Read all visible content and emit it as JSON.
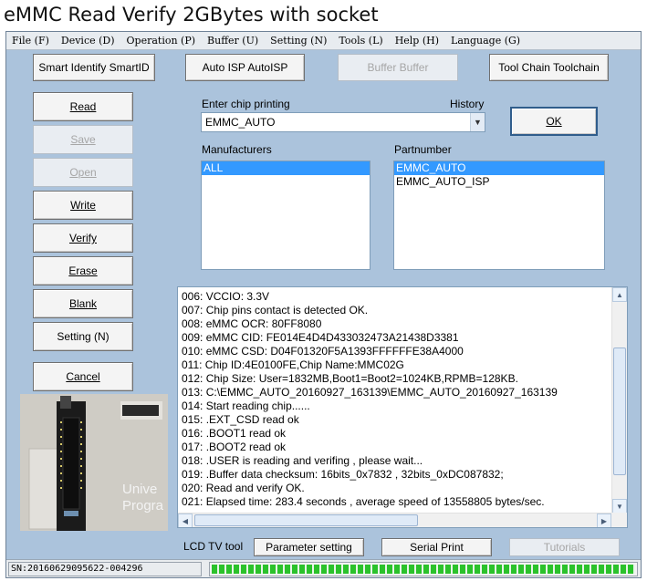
{
  "page_heading": "eMMC Read Verify 2GBytes with socket",
  "menu": [
    {
      "label": "File (F)"
    },
    {
      "label": "Device (D)"
    },
    {
      "label": "Operation (P)"
    },
    {
      "label": "Buffer (U)"
    },
    {
      "label": "Setting (N)"
    },
    {
      "label": "Tools (L)"
    },
    {
      "label": "Help (H)"
    },
    {
      "label": "Language (G)"
    }
  ],
  "top_toolbar": {
    "smart_identify": "Smart Identify SmartID",
    "auto_isp": "Auto ISP AutoISP",
    "buffer": "Buffer Buffer",
    "tool_chain": "Tool Chain Toolchain"
  },
  "left_buttons": {
    "read": "Read",
    "save": "Save",
    "open": "Open",
    "write": "Write",
    "verify": "Verify",
    "erase": "Erase",
    "blank": "Blank",
    "setting": "Setting (N)",
    "cancel": "Cancel"
  },
  "chip_select": {
    "enter_label": "Enter chip printing",
    "history_label": "History",
    "value": "EMMC_AUTO",
    "ok_label": "OK",
    "manufacturers_label": "Manufacturers",
    "partnumber_label": "Partnumber",
    "manufacturers": [
      "ALL"
    ],
    "partnumbers": [
      "EMMC_AUTO",
      "EMMC_AUTO_ISP"
    ]
  },
  "log": [
    "006: VCCIO: 3.3V",
    "007: Chip pins contact is detected OK.",
    "008: eMMC OCR: 80FF8080",
    "009: eMMC CID:  FE014E4D4D433032473A21438D3381",
    "010: eMMC CSD: D04F01320F5A1393FFFFFFE38A4000",
    "011: Chip ID:4E0100FE,Chip Name:MMC02G",
    "012: Chip Size: User=1832MB,Boot1=Boot2=1024KB,RPMB=128KB.",
    "013: C:\\EMMC_AUTO_20160927_163139\\EMMC_AUTO_20160927_163139",
    "014: Start reading chip......",
    "015: .EXT_CSD read ok",
    "016: .BOOT1 read ok",
    "017: .BOOT2 read ok",
    "018: .USER is reading and verifing , please wait...",
    "019: .Buffer data checksum: 16bits_0x7832 , 32bits_0xDC087832;",
    "020: Read and verify OK.",
    "021: Elapsed time: 283.4 seconds , average speed of 13558805 bytes/sec."
  ],
  "photo": {
    "text_line1": "Unive",
    "text_line2": "Progra"
  },
  "bottom_bar": {
    "lcd_label": "LCD TV tool",
    "parameter_setting": "Parameter setting",
    "serial_print": "Serial Print",
    "tutorials": "Tutorials"
  },
  "status": {
    "serial_number": "SN:20160629095622-004296",
    "progress_percent": 100
  },
  "colors": {
    "window_bg": "#abc3dc",
    "selection": "#3399ff",
    "progress": "#2bc22b"
  }
}
